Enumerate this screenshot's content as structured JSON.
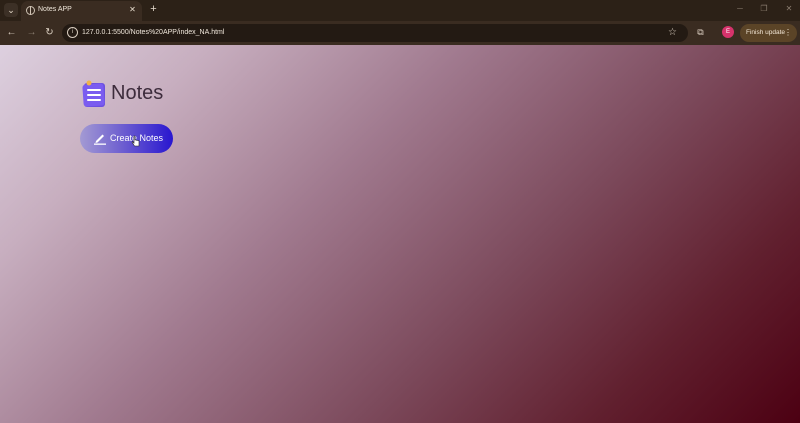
{
  "browser": {
    "tab": {
      "title": "Notes APP",
      "close_glyph": "✕"
    },
    "new_tab_glyph": "+",
    "address": {
      "url": "127.0.0.1:5500/Notes%20APP/index_NA.html"
    },
    "profile_initial": "E",
    "finish_update_label": "Finish update",
    "icons": [
      "tab-search-icon",
      "globe-icon",
      "back-icon",
      "forward-icon",
      "reload-icon",
      "site-info-icon",
      "star-icon",
      "extensions-icon",
      "more-icon",
      "minimize-icon",
      "maximize-icon",
      "close-icon"
    ]
  },
  "page": {
    "brand": {
      "title": "Notes",
      "logo_icon": "notepad-icon"
    },
    "create_button": {
      "label": "Create Notes",
      "icon": "pencil-icon"
    }
  },
  "colors": {
    "accent_start": "#a39ad3",
    "accent_end": "#2816d0",
    "gradient_light": "#ddd0df",
    "gradient_dark": "#4c0012"
  }
}
